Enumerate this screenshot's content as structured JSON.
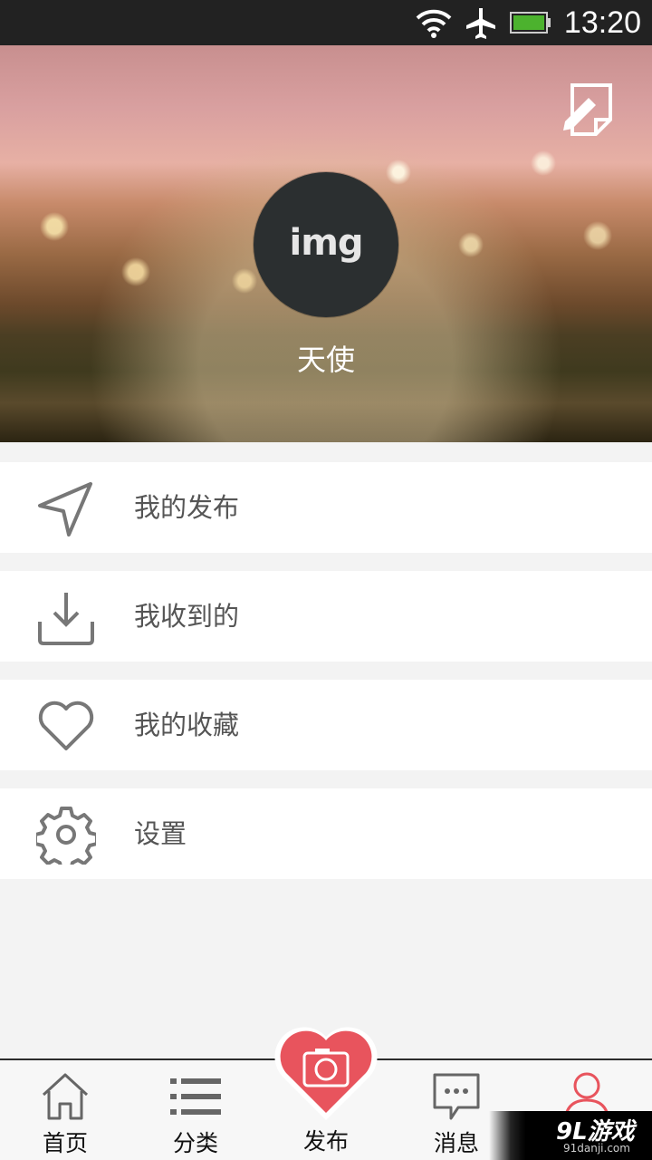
{
  "status_bar": {
    "time": "13:20",
    "icons": [
      "wifi-icon",
      "airplane-mode-icon",
      "battery-icon"
    ]
  },
  "profile": {
    "avatar_text": "img",
    "username": "天使",
    "edit_icon": "edit-icon"
  },
  "menu": {
    "items": [
      {
        "label": "我的发布",
        "icon": "send-icon"
      },
      {
        "label": "我收到的",
        "icon": "download-icon"
      },
      {
        "label": "我的收藏",
        "icon": "heart-icon"
      },
      {
        "label": "设置",
        "icon": "gear-icon"
      }
    ]
  },
  "tabbar": {
    "tabs": [
      {
        "label": "首页",
        "icon": "home-icon"
      },
      {
        "label": "分类",
        "icon": "list-icon"
      },
      {
        "label": "发布",
        "icon": "camera-heart-icon"
      },
      {
        "label": "消息",
        "icon": "message-icon"
      },
      {
        "label": "",
        "icon": "user-icon",
        "active": true
      }
    ]
  },
  "watermark": {
    "logo": "9L游戏",
    "url": "91danji.com"
  },
  "colors": {
    "accent": "#e8545d",
    "status_bar": "#222222",
    "background": "#f3f3f3",
    "icon_gray": "#777777"
  }
}
